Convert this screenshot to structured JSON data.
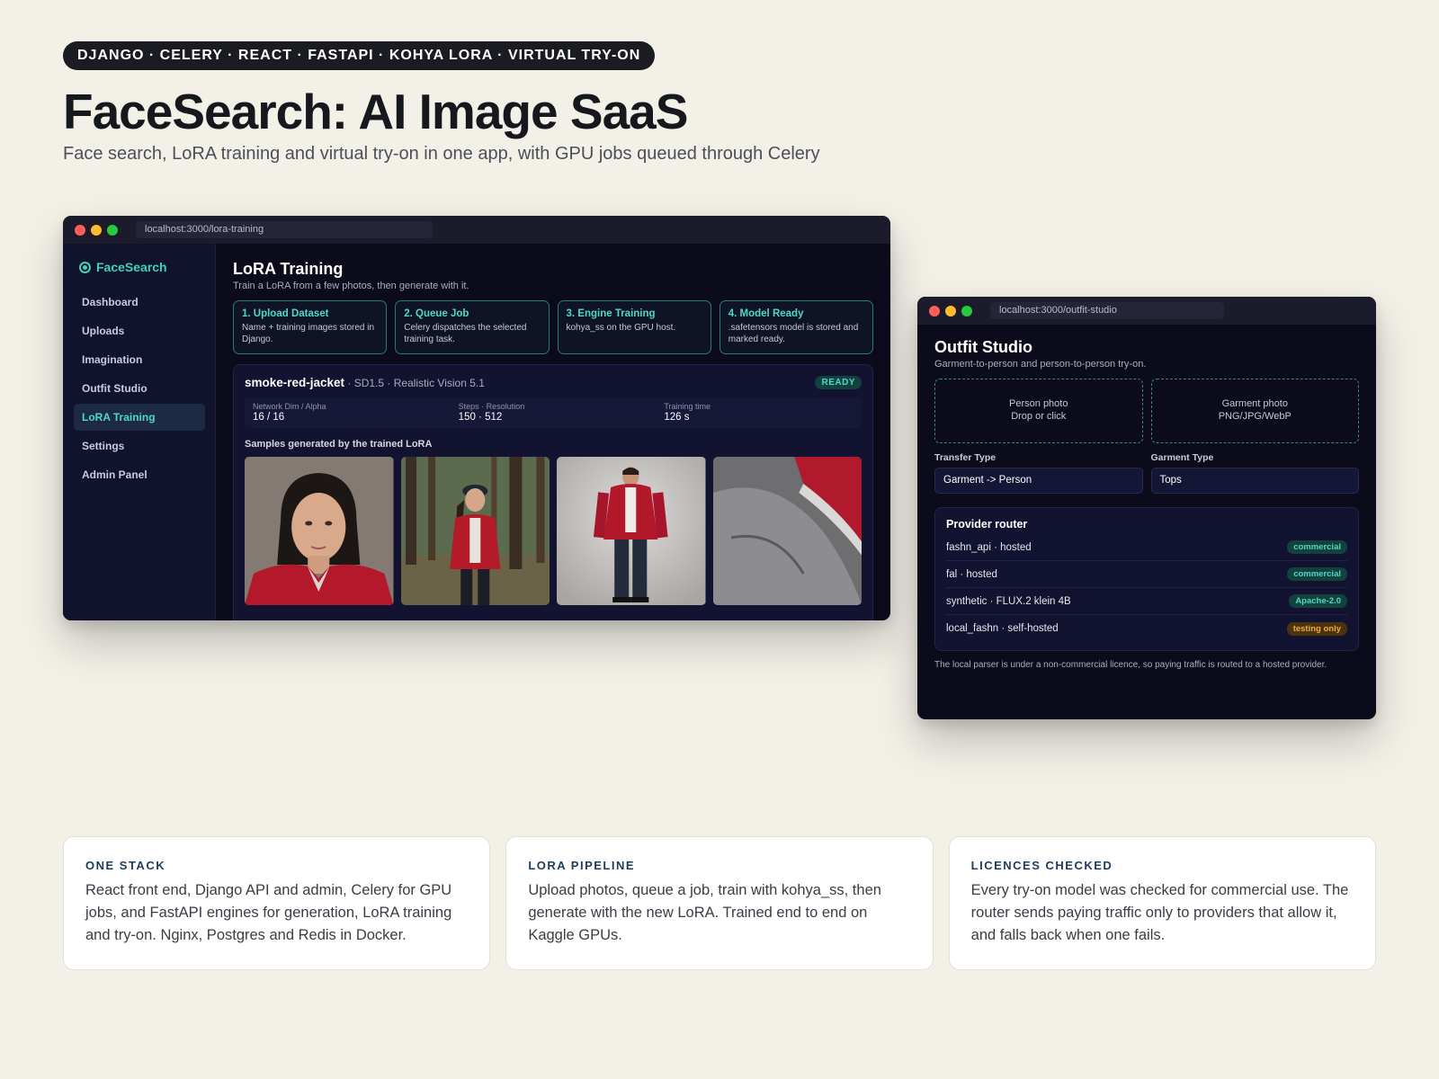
{
  "header": {
    "tech_pill": "DJANGO · CELERY · REACT · FASTAPI · KOHYA LORA · VIRTUAL TRY-ON",
    "title": "FaceSearch: AI Image SaaS",
    "subtitle": "Face search, LoRA training and virtual try-on in one app, with GPU jobs queued through Celery"
  },
  "lora_window": {
    "url": "localhost:3000/lora-training",
    "brand": "FaceSearch",
    "nav": [
      "Dashboard",
      "Uploads",
      "Imagination",
      "Outfit Studio",
      "LoRA Training",
      "Settings",
      "Admin Panel"
    ],
    "active_nav": "LoRA Training",
    "page_title": "LoRA Training",
    "page_subtitle": "Train a LoRA from a few photos, then generate with it.",
    "steps": [
      {
        "title": "1. Upload Dataset",
        "desc": "Name + training images stored in Django."
      },
      {
        "title": "2. Queue Job",
        "desc": "Celery dispatches the selected training task."
      },
      {
        "title": "3. Engine Training",
        "desc": "kohya_ss on the GPU host."
      },
      {
        "title": "4. Model Ready",
        "desc": ".safetensors model is stored and marked ready."
      }
    ],
    "model": {
      "name": "smoke-red-jacket",
      "base": " · SD1.5 · Realistic Vision 5.1",
      "status": "READY",
      "stats": [
        {
          "label": "Network Dim / Alpha",
          "value": "16 / 16"
        },
        {
          "label": "Steps · Resolution",
          "value": "150 · 512"
        },
        {
          "label": "Training time",
          "value": "126 s"
        }
      ],
      "samples_label": "Samples generated by the trained LoRA"
    }
  },
  "outfit_window": {
    "url": "localhost:3000/outfit-studio",
    "title": "Outfit Studio",
    "subtitle": "Garment-to-person and person-to-person try-on.",
    "dropzones": [
      {
        "line1": "Person photo",
        "line2": "Drop or click"
      },
      {
        "line1": "Garment photo",
        "line2": "PNG/JPG/WebP"
      }
    ],
    "transfer_type": {
      "label": "Transfer Type",
      "value": "Garment -> Person"
    },
    "garment_type": {
      "label": "Garment Type",
      "value": "Tops"
    },
    "router": {
      "title": "Provider router",
      "providers": [
        {
          "name": "fashn_api · hosted",
          "tag": "commercial"
        },
        {
          "name": "fal · hosted",
          "tag": "commercial"
        },
        {
          "name": "synthetic · FLUX.2 klein 4B",
          "tag": "Apache-2.0"
        },
        {
          "name": "local_fashn · self-hosted",
          "tag": "testing only"
        }
      ]
    },
    "footnote": "The local parser is under a non-commercial licence, so paying traffic is routed to a hosted provider."
  },
  "cards": [
    {
      "kicker": "ONE STACK",
      "body": "React front end, Django API and admin, Celery for GPU jobs, and FastAPI engines for generation, LoRA training and try-on. Nginx, Postgres and Redis in Docker."
    },
    {
      "kicker": "LORA PIPELINE",
      "body": "Upload photos, queue a job, train with kohya_ss, then generate with the new LoRA. Trained end to end on Kaggle GPUs."
    },
    {
      "kicker": "LICENCES CHECKED",
      "body": "Every try-on model was checked for commercial use. The router sends paying traffic only to providers that allow it, and falls back when one fails."
    }
  ],
  "colors": {
    "accent": "#4fd8c6",
    "warning": "#f2a93b",
    "background": "#f3f0e8"
  }
}
